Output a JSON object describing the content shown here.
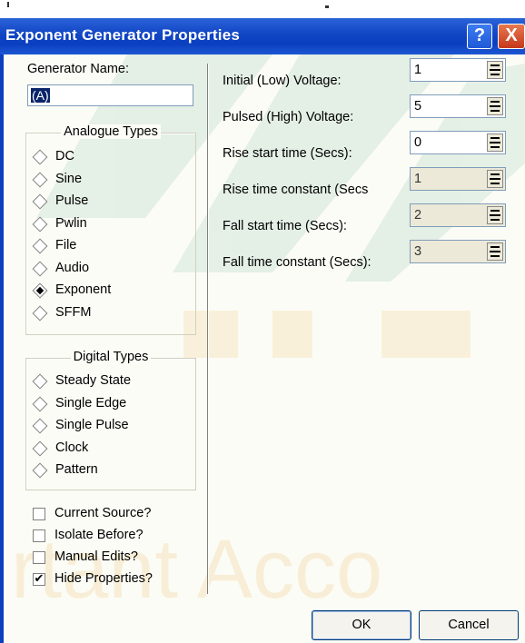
{
  "window": {
    "title": "Exponent Generator Properties",
    "help_glyph": "?",
    "close_glyph": "X"
  },
  "left": {
    "generator_name_label": "Generator Name:",
    "generator_name_value": "(A)",
    "analogue_title": "Analogue Types",
    "analogue_types": [
      "DC",
      "Sine",
      "Pulse",
      "Pwlin",
      "File",
      "Audio",
      "Exponent",
      "SFFM"
    ],
    "analogue_selected": "Exponent",
    "digital_title": "Digital Types",
    "digital_types": [
      "Steady State",
      "Single Edge",
      "Single Pulse",
      "Clock",
      "Pattern"
    ],
    "options": [
      {
        "label": "Current Source?",
        "checked": false
      },
      {
        "label": "Isolate Before?",
        "checked": false
      },
      {
        "label": "Manual Edits?",
        "checked": false
      },
      {
        "label": "Hide Properties?",
        "checked": true
      }
    ],
    "check_glyph": "✔"
  },
  "params": [
    {
      "label": "Initial (Low) Voltage:",
      "value": "1",
      "enabled": true
    },
    {
      "label": "Pulsed (High) Voltage:",
      "value": "5",
      "enabled": true
    },
    {
      "label": "Rise start time (Secs):",
      "value": "0",
      "enabled": true
    },
    {
      "label": "Rise time constant (Secs",
      "value": "1",
      "enabled": false
    },
    {
      "label": "Fall start time (Secs):",
      "value": "2",
      "enabled": false
    },
    {
      "label": "Fall time constant (Secs):",
      "value": "3",
      "enabled": false
    }
  ],
  "buttons": {
    "ok": "OK",
    "cancel": "Cancel"
  },
  "watermark": {
    "text": "rtant Acco",
    "color": "#e9a93a"
  },
  "colors": {
    "titlebar": "#0a3fc0",
    "selection": "#0a246a",
    "face": "#fcfcf6"
  }
}
